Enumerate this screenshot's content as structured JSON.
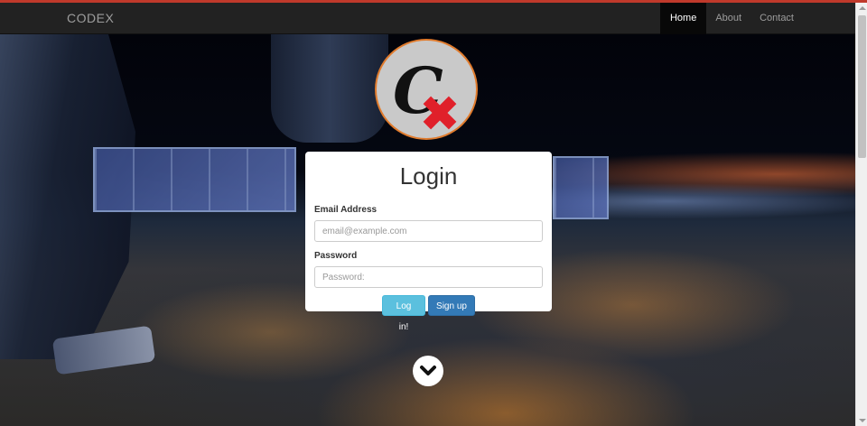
{
  "navbar": {
    "brand": "CODEX",
    "items": [
      {
        "label": "Home",
        "active": true
      },
      {
        "label": "About",
        "active": false
      },
      {
        "label": "Contact",
        "active": false
      }
    ]
  },
  "login": {
    "title": "Login",
    "email_label": "Email Address",
    "email_placeholder": "email@example.com",
    "password_label": "Password",
    "password_placeholder": "Password:",
    "login_button": "Log in!",
    "signup_button": "Sign up"
  },
  "colors": {
    "accent": "#c0392b",
    "navbar_bg": "#222222",
    "login_button": "#5bc0de",
    "signup_button": "#337ab7",
    "logo_ring": "#e07b2d"
  },
  "icons": {
    "logo": "codex-logo",
    "scroll": "chevron-down-icon"
  }
}
